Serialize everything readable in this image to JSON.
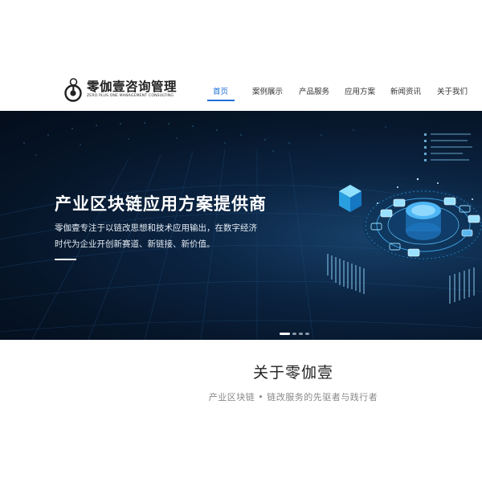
{
  "brand": {
    "name_cn": "零伽壹咨询管理",
    "name_en": "ZERO PLUS ONE  MANAGEMENT CONSULTING",
    "logo_icon": "logo-mark-icon"
  },
  "nav": {
    "items": [
      {
        "label": "首页",
        "active": true
      },
      {
        "label": "案例展示",
        "active": false
      },
      {
        "label": "产品服务",
        "active": false
      },
      {
        "label": "应用方案",
        "active": false
      },
      {
        "label": "新闻资讯",
        "active": false
      },
      {
        "label": "关于我们",
        "active": false
      }
    ],
    "active_color": "#1e6fd9"
  },
  "hero": {
    "title": "产业区块链应用方案提供商",
    "desc_line1": "零伽壹专注于以链改思想和技术应用输出，在数字经济",
    "desc_line2": "时代为企业开创新赛道、新链接、新价值。",
    "slides_total": 4,
    "active_slide": 1
  },
  "about": {
    "title": "关于零伽壹",
    "subtitle": "产业区块链 • 链改服务的先驱者与践行者"
  }
}
